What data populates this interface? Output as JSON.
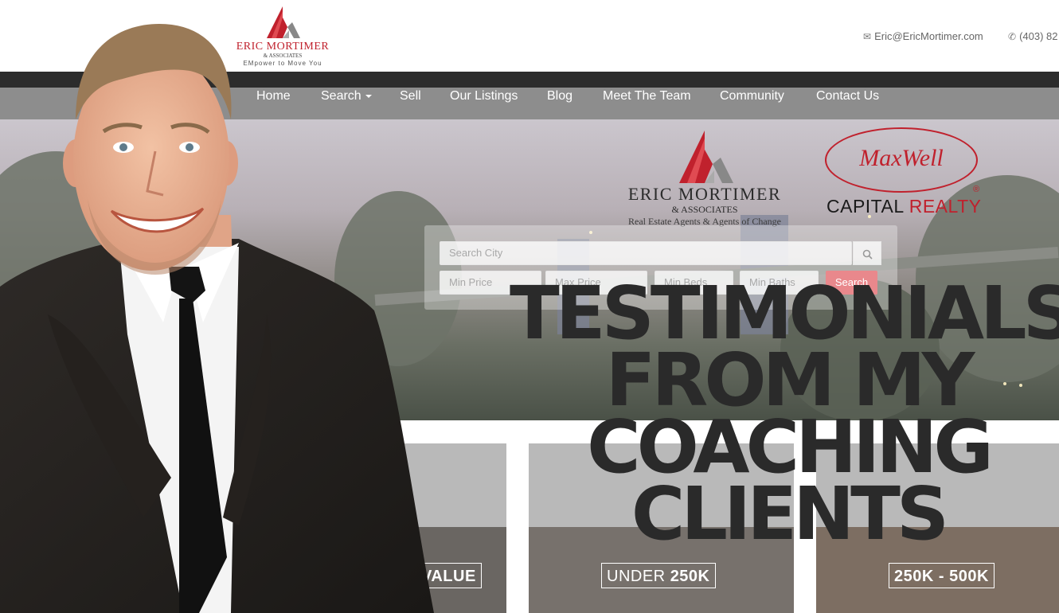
{
  "header": {
    "logo": {
      "line1": "ERIC MORTIMER",
      "line2": "& ASSOCIATES",
      "line3": "EMpower to Move You"
    },
    "email": "Eric@EricMortimer.com",
    "phone": "(403) 82"
  },
  "nav": {
    "items": [
      {
        "label": "Home"
      },
      {
        "label": "Search"
      },
      {
        "label": "Sell"
      },
      {
        "label": "Our Listings"
      },
      {
        "label": "Blog"
      },
      {
        "label": "Meet The Team"
      },
      {
        "label": "Community"
      },
      {
        "label": "Contact Us"
      }
    ]
  },
  "hero": {
    "brand": {
      "line1": "ERIC MORTIMER",
      "line2": "& ASSOCIATES",
      "line3": "Real Estate Agents & Agents of Change"
    },
    "maxwell": {
      "name": "MaxWell",
      "capital": "CAPITAL",
      "realty": "REALTY",
      "registered": "®"
    },
    "search": {
      "city_placeholder": "Search City",
      "min_price_placeholder": "Min Price",
      "max_price_placeholder": "Max Price",
      "min_beds_placeholder": "Min Beds",
      "min_baths_placeholder": "Min Baths",
      "button_label": "Search"
    }
  },
  "cards": [
    {
      "label": "VALUE"
    },
    {
      "label_prefix": "UNDER",
      "label_value": "250K"
    },
    {
      "label": "250K - 500K"
    }
  ],
  "overlay": {
    "lines": [
      "TESTIMONIALS",
      "FROM MY",
      "COACHING",
      "CLIENTS"
    ]
  },
  "colors": {
    "brand_red": "#c0212d",
    "nav_gray": "#8d8d8d",
    "nav_dark": "#2c2c2c",
    "search_button": "#e9888c",
    "title_dark": "#2a2a2a"
  }
}
